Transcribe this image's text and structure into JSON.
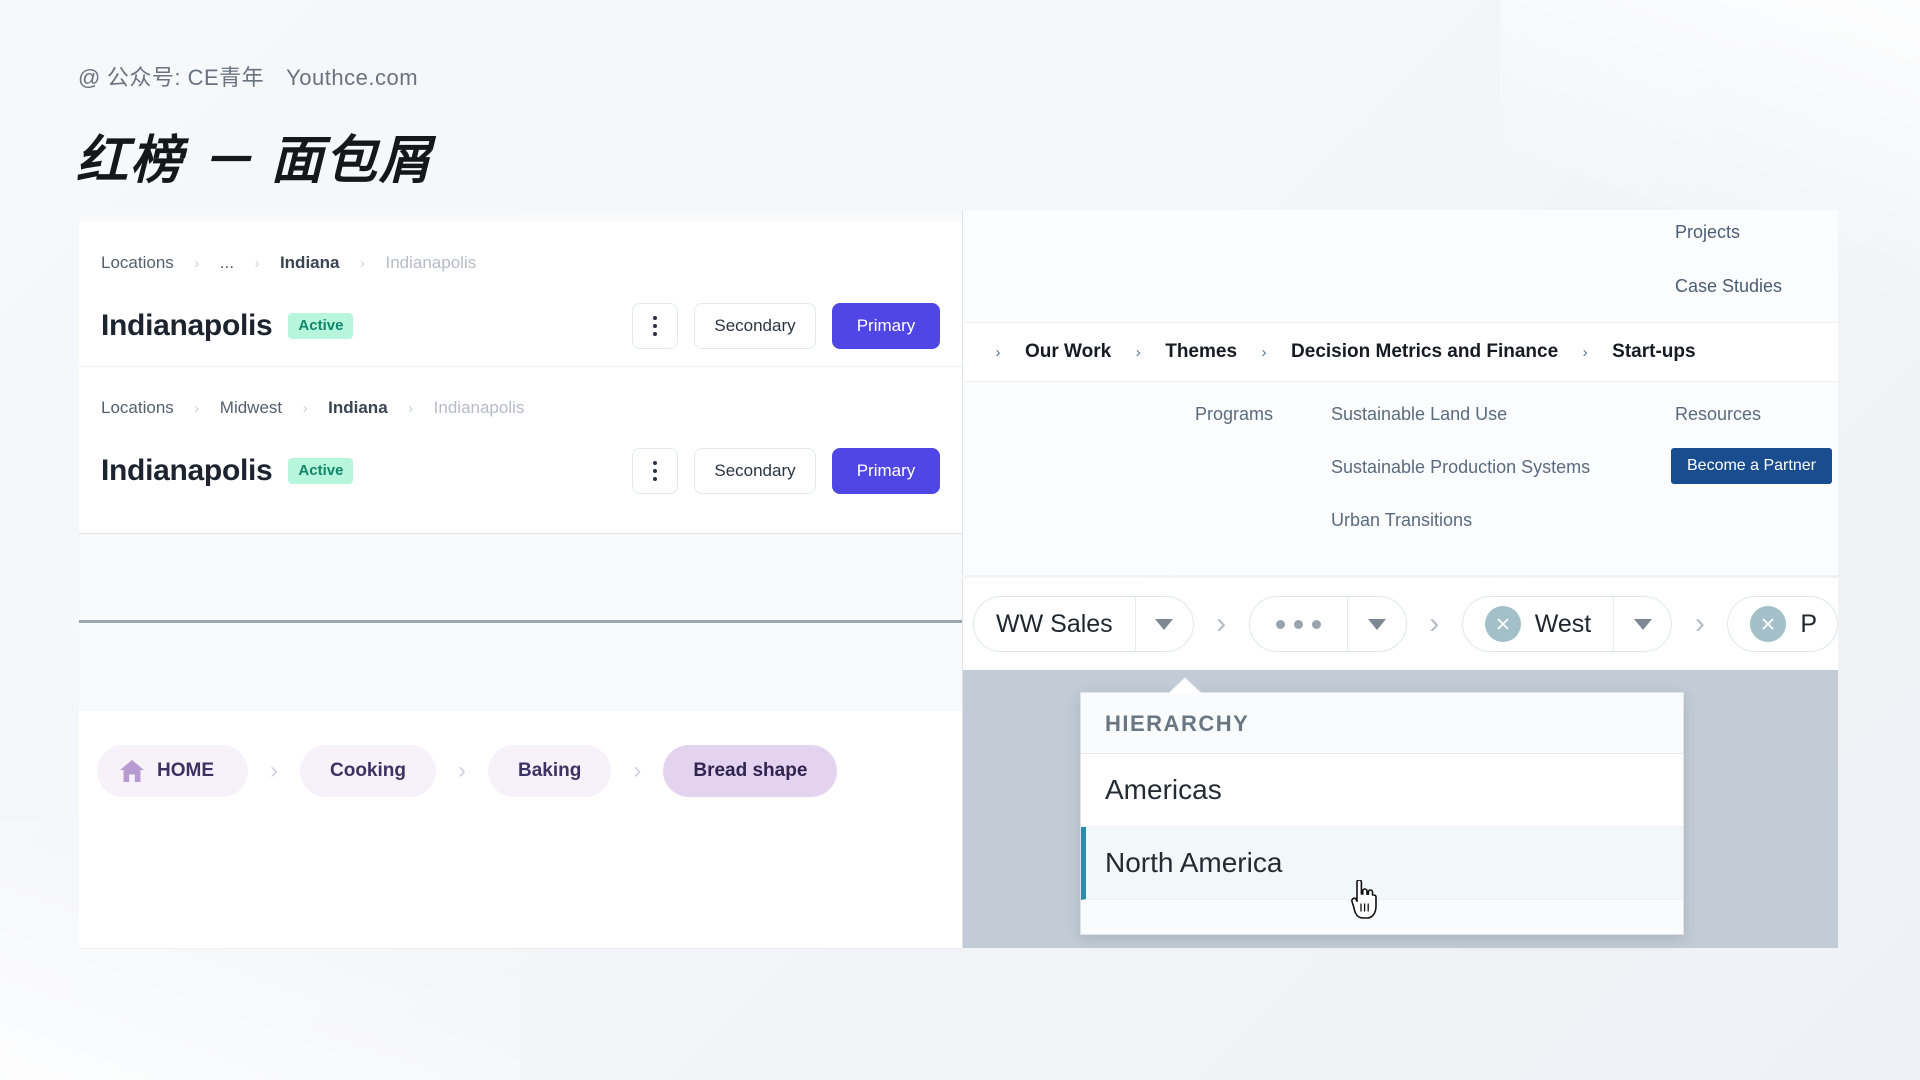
{
  "header": {
    "watermark_at": "@",
    "watermark_text": "公众号: CE青年",
    "watermark_site": "Youthce.com",
    "title": "红榜 － 面包屑"
  },
  "left_panel": {
    "cards": [
      {
        "crumbs": [
          {
            "label": "Locations",
            "style": "normal"
          },
          {
            "label": "...",
            "style": "normal"
          },
          {
            "label": "Indiana",
            "style": "strong"
          },
          {
            "label": "Indianapolis",
            "style": "muted"
          }
        ],
        "title": "Indianapolis",
        "badge": "Active",
        "kebab_label": "more-options",
        "secondary_label": "Secondary",
        "primary_label": "Primary"
      },
      {
        "crumbs": [
          {
            "label": "Locations",
            "style": "normal"
          },
          {
            "label": "Midwest",
            "style": "normal"
          },
          {
            "label": "Indiana",
            "style": "strong"
          },
          {
            "label": "Indianapolis",
            "style": "muted"
          }
        ],
        "title": "Indianapolis",
        "badge": "Active",
        "kebab_label": "more-options",
        "secondary_label": "Secondary",
        "primary_label": "Primary"
      }
    ],
    "separator": "›",
    "pill_breadcrumb": {
      "separator": "›",
      "items": [
        {
          "label": "HOME",
          "icon": "home-icon",
          "current": false
        },
        {
          "label": "Cooking",
          "icon": "",
          "current": false
        },
        {
          "label": "Baking",
          "icon": "",
          "current": false
        },
        {
          "label": "Bread shape",
          "icon": "",
          "current": true
        }
      ]
    }
  },
  "mega_menu": {
    "upper_links": [
      {
        "label": "Projects"
      },
      {
        "label": "Case Studies"
      }
    ],
    "chevron": "›",
    "trail": [
      {
        "label": "Our Work"
      },
      {
        "label": "Themes"
      },
      {
        "label": "Decision Metrics and Finance"
      },
      {
        "label": "Start-ups"
      }
    ],
    "sub_links": [
      {
        "label": "Programs"
      },
      {
        "label": "Sustainable Land Use"
      },
      {
        "label": "Sustainable Production Systems"
      },
      {
        "label": "Urban Transitions"
      },
      {
        "label": "Resources"
      }
    ],
    "cta_label": "Become a Partner",
    "cta_color": "#1a4d8f"
  },
  "hierarchy_bar": {
    "separator": "›",
    "chips": [
      {
        "label": "WW Sales",
        "type": "text",
        "has_caret": true,
        "has_close": false
      },
      {
        "label": "",
        "type": "ellipsis",
        "has_caret": true,
        "has_close": false,
        "open": true
      },
      {
        "label": "West",
        "type": "text",
        "has_caret": true,
        "has_close": true
      },
      {
        "label": "P",
        "type": "text",
        "has_caret": false,
        "has_close": true
      }
    ]
  },
  "dropdown": {
    "header": "HIERARCHY",
    "items": [
      {
        "label": "Americas",
        "selected": false
      },
      {
        "label": "North America",
        "selected": true
      }
    ],
    "accent_color": "#2b8cad"
  },
  "colors": {
    "primary": "#4f46e5",
    "badge_bg": "#b8f5dd",
    "badge_text": "#11866a",
    "pill_bg": "#f7f1fa",
    "pill_current_bg": "#e4d3ee",
    "cta": "#1a4d8f"
  }
}
